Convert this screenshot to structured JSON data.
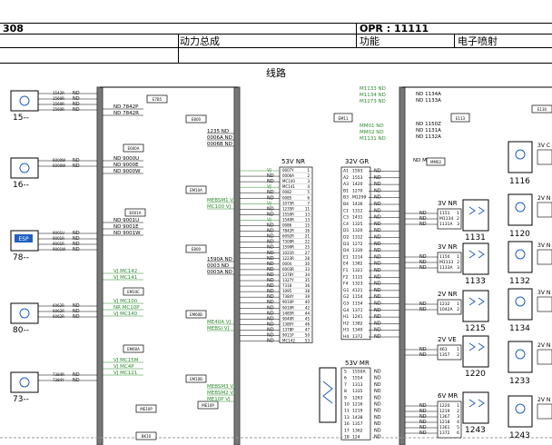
{
  "header": {
    "doc_no": "308",
    "opr_label": "OPR : 11111",
    "category": "动力总成",
    "function_label": "功能",
    "function_value": "电子喷射",
    "section_title": "线路"
  },
  "components_left": [
    {
      "id": "15--",
      "pins": [
        "1542R",
        "1560R",
        "1560R",
        "1560R"
      ],
      "nd": [
        "ND",
        "ND",
        "ND",
        "ND"
      ]
    },
    {
      "id": "16--",
      "pins": [
        "6000W",
        "6000W"
      ],
      "nd": [
        "ND",
        "ND"
      ]
    },
    {
      "id": "78--",
      "badge": "ESP",
      "pins": [
        "9001U",
        "9001R",
        "9001R",
        "9001W"
      ],
      "nd": [
        "ND",
        "ND",
        "ND",
        "ND"
      ]
    },
    {
      "id": "80--",
      "pins": [
        "6062R",
        "6062R",
        "6062R"
      ],
      "nd": [
        "ND",
        "ND",
        "ND"
      ]
    },
    {
      "id": "73--",
      "pins": [
        "7384R",
        "7384Y"
      ],
      "nd": [
        "ND",
        "ND"
      ]
    }
  ],
  "left_bus_labels": [
    "ND 7842P",
    "ND 7842R",
    "ND 9000U",
    "ND 9000E",
    "ND 9000W",
    "ND 9001U",
    "ND 9001E",
    "ND 9001W",
    "VJ MC142",
    "VJ MC141",
    "VJ MC100",
    "NR MC10P",
    "VJ MC140",
    "VJ MC15M",
    "VJ MC4P",
    "VJ MC121"
  ],
  "mid_labels": [
    "1235 ND",
    "0006A ND",
    "0006B ND",
    "MEBSM1 VJ",
    "MC100 VJ",
    "1590A ND",
    "0003 ND",
    "0003A ND",
    "ME40A VJ",
    "MEBSI VJ",
    "MEBSM3 VJ",
    "MEBSM2 VJ",
    "ME10P VJ"
  ],
  "box_labels": [
    "E7B5",
    "E800",
    "E600A",
    "EM10A",
    "E601A",
    "E800",
    "EM10C",
    "EM60B",
    "EM60A",
    "EM10B",
    "ME10P",
    "BK10",
    "ME10P"
  ],
  "connector_53v": {
    "title": "53V NR",
    "rows": [
      [
        "0007Y",
        "1"
      ],
      [
        "0006A",
        "2"
      ],
      [
        "MC140",
        "3"
      ],
      [
        "MC141",
        "4"
      ],
      [
        "0082",
        "5"
      ],
      [
        "0085",
        "6"
      ],
      [
        "1075R",
        "7"
      ],
      [
        "1235R",
        "11"
      ],
      [
        "1550R",
        "13"
      ],
      [
        "1540R",
        "13"
      ],
      [
        "0086",
        "15"
      ],
      [
        "7842R",
        "16"
      ],
      [
        "6092R",
        "21"
      ],
      [
        "7309R",
        "22"
      ],
      [
        "1599R",
        "25"
      ],
      [
        "1021R",
        "27"
      ],
      [
        "1223R",
        "28"
      ],
      [
        "0004",
        "30"
      ],
      [
        "6003R",
        "33"
      ],
      [
        "1378Y",
        "34"
      ],
      [
        "1327Y",
        "35"
      ],
      [
        "7318",
        "36"
      ],
      [
        "1095",
        "38"
      ],
      [
        "7384Y",
        "39"
      ],
      [
        "9010P",
        "40"
      ],
      [
        "9010R",
        "42"
      ],
      [
        "1485R",
        "44"
      ],
      [
        "9040R",
        "45"
      ],
      [
        "1380Y",
        "46"
      ],
      [
        "1378P",
        "47"
      ],
      [
        "9011P",
        "50"
      ],
      [
        "MC142",
        "53"
      ]
    ]
  },
  "connector_32v": {
    "title": "32V GR",
    "rows": [
      [
        "A1",
        "1593",
        "ND"
      ],
      [
        "A2",
        "1553",
        "ND"
      ],
      [
        "A3",
        "1420",
        "ND"
      ],
      [
        "B1",
        "1270",
        "ND"
      ],
      [
        "B3",
        "M1299",
        "ND"
      ],
      [
        "B4",
        "1436",
        "ND"
      ],
      [
        "C1",
        "1312",
        "ND"
      ],
      [
        "C3",
        "1431",
        "ND"
      ],
      [
        "C4",
        "1325",
        "ND"
      ],
      [
        "D1",
        "1320",
        "ND"
      ],
      [
        "D2",
        "1312",
        "ND"
      ],
      [
        "D3",
        "1272",
        "ND"
      ],
      [
        "D4",
        "1330",
        "ND"
      ],
      [
        "E1",
        "1214",
        "ND"
      ],
      [
        "E4",
        "1382",
        "ND"
      ],
      [
        "F1",
        "1321",
        "ND"
      ],
      [
        "F2",
        "1115",
        "ND"
      ],
      [
        "F4",
        "1323",
        "ND"
      ],
      [
        "G1",
        "4121",
        "ND"
      ],
      [
        "G2",
        "1154",
        "ND"
      ],
      [
        "G3",
        "1154",
        "ND"
      ],
      [
        "G4",
        "1371",
        "ND"
      ],
      [
        "H1",
        "1241",
        "ND"
      ],
      [
        "H2",
        "1382",
        "ND"
      ],
      [
        "H3",
        "1340",
        "ND"
      ],
      [
        "H4",
        "1372",
        "ND"
      ]
    ]
  },
  "connector_53v_mr": {
    "title": "53V MR",
    "rows": [
      [
        "5",
        "1550A"
      ],
      [
        "6",
        "1554"
      ],
      [
        "7",
        "1313"
      ],
      [
        "8",
        "1335"
      ],
      [
        "9",
        "1263"
      ],
      [
        "10",
        "1216"
      ],
      [
        "11",
        "1219"
      ],
      [
        "13",
        "1438"
      ],
      [
        "16",
        "1357"
      ],
      [
        "17",
        "1362"
      ],
      [
        "18",
        "124"
      ]
    ]
  },
  "top_right_labels": [
    "M1133 ND",
    "M1134 ND",
    "M1273 ND",
    "MM01 ND",
    "MM02 ND",
    "M1131 ND",
    "ND 1134A",
    "ND 1133A",
    "ND 1150Z",
    "ND 1131A",
    "ND 1132A",
    "ND MM02"
  ],
  "right_connectors": [
    {
      "title": "3V NR",
      "pins": [
        "1151",
        "M1134",
        "1131A"
      ],
      "id": "1131"
    },
    {
      "title": "3V NR",
      "pins": [
        "1150",
        "M1133",
        "1133A"
      ],
      "id": "1133"
    },
    {
      "title": "2V NR",
      "pins": [
        "1232",
        "1042A"
      ],
      "id": "1215"
    },
    {
      "title": "2V VE",
      "pins": [
        "461",
        "1357"
      ],
      "id": "1220"
    },
    {
      "title": "6V MR",
      "pins": [
        "1220",
        "1219",
        "1367",
        "1218",
        "1361",
        "1372"
      ],
      "id": "1243"
    }
  ],
  "far_right_ids": [
    "1116",
    "1120",
    "1132",
    "1134",
    "1233",
    "1243"
  ],
  "far_right_titles": [
    "3V C",
    "2V N",
    "3V N",
    "3V N",
    "2V N",
    "2V N",
    "2V N"
  ],
  "wire_colors": {
    "ND": "#000000",
    "VJ": "#2e8b2e",
    "NR": "#2e8b2e",
    "MR": "#000000"
  },
  "accent": {
    "green": "#2e8b2e",
    "blue": "#1f5fbf"
  }
}
